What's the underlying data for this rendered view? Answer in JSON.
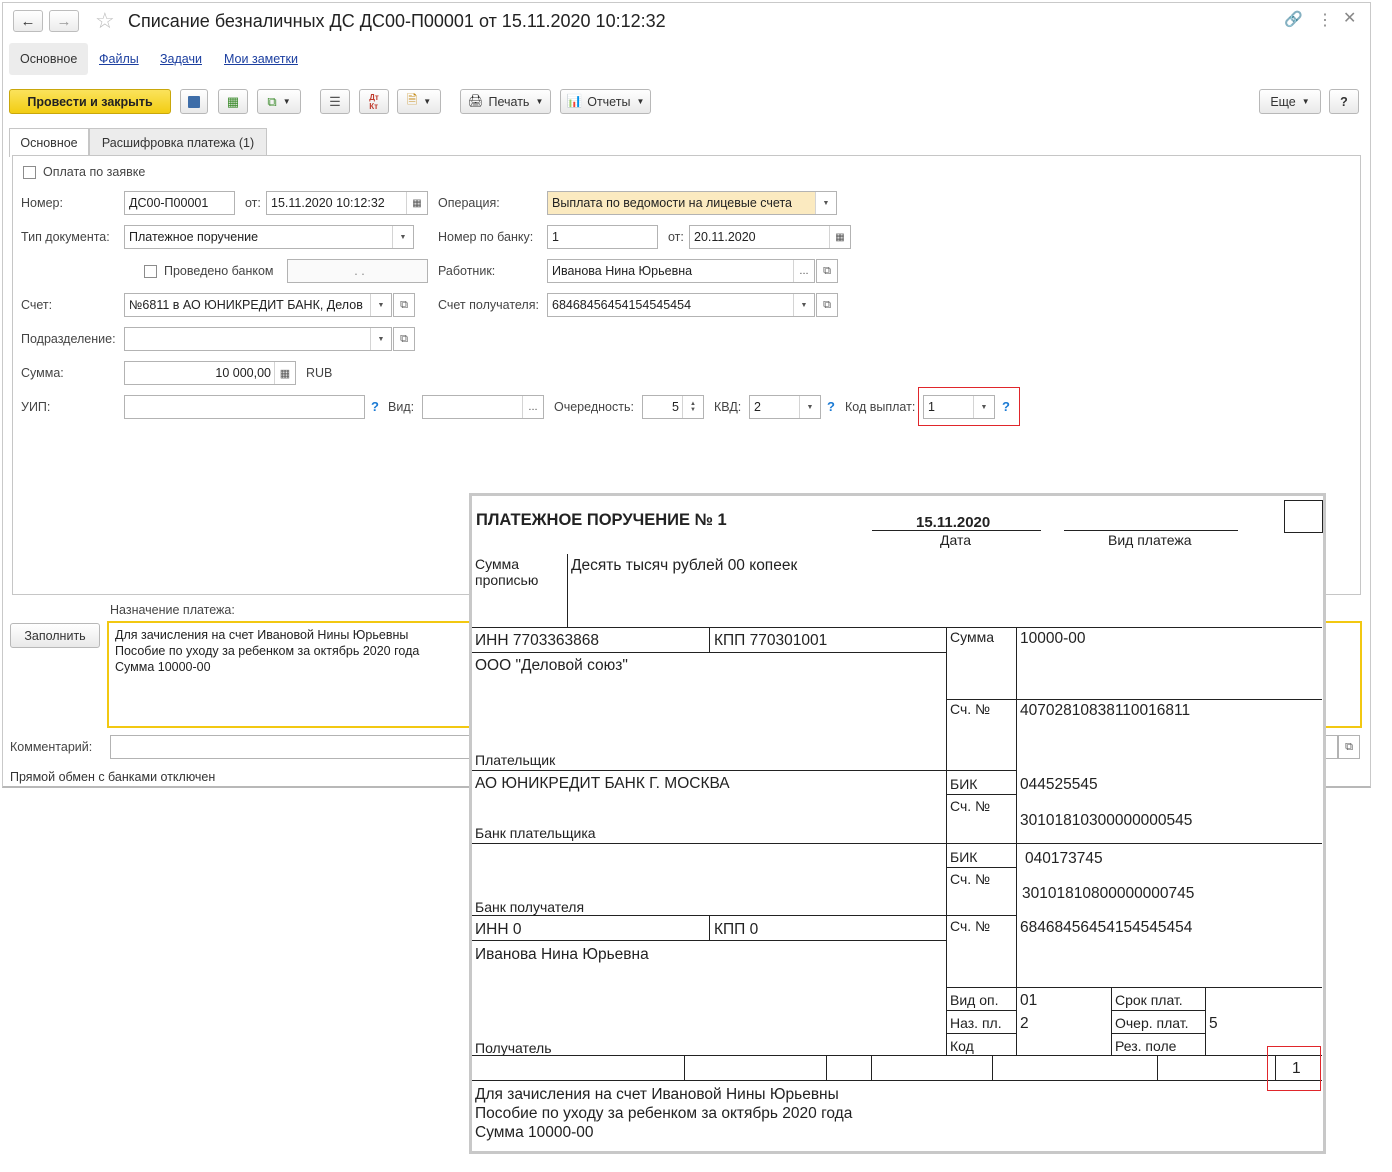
{
  "window": {
    "title": "Списание безналичных ДС ДС00-П00001 от 15.11.2020 10:12:32",
    "section_tabs": [
      "Основное",
      "Файлы",
      "Задачи",
      "Мои заметки"
    ],
    "toolbar": {
      "post_close": "Провести и закрыть",
      "print": "Печать",
      "reports": "Отчеты",
      "more": "Еще",
      "help": "?"
    },
    "tabs": [
      "Основное",
      "Расшифровка платежа (1)"
    ]
  },
  "form": {
    "request_payment_label": "Оплата по заявке",
    "number_label": "Номер:",
    "number": "ДС00-П00001",
    "from_label": "от:",
    "date": "15.11.2020 10:12:32",
    "operation_label": "Операция:",
    "operation": "Выплата по ведомости на лицевые счета",
    "doc_type_label": "Тип документа:",
    "doc_type": "Платежное поручение",
    "bank_number_label": "Номер по банку:",
    "bank_number": "1",
    "bank_from_label": "от:",
    "bank_date": "20.11.2020",
    "bank_processed_label": "Проведено банком",
    "bank_processed_date": ".  .",
    "employee_label": "Работник:",
    "employee": "Иванова Нина Юрьевна",
    "account_label": "Счет:",
    "account": "№6811 в АО ЮНИКРЕДИТ БАНК, Делов",
    "recipient_account_label": "Счет получателя:",
    "recipient_account": "68468456454154545454",
    "division_label": "Подразделение:",
    "division": "",
    "amount_label": "Сумма:",
    "amount": "10 000,00",
    "currency": "RUB",
    "uip_label": "УИП:",
    "uip": "",
    "kind_label": "Вид:",
    "kind": "",
    "priority_label": "Очередность:",
    "priority": "5",
    "kvd_label": "КВД:",
    "kvd": "2",
    "payout_code_label": "Код выплат:",
    "payout_code": "1",
    "purpose_label": "Назначение платежа:",
    "fill_button": "Заполнить",
    "purpose_lines": [
      "Для зачисления на счет Ивановой Нины Юрьевны",
      "Пособие по уходу за ребенком за октябрь 2020 года",
      "Сумма 10000-00"
    ],
    "comment_label": "Комментарий:",
    "comment": "",
    "status": "Прямой обмен с банками отключен"
  },
  "payment_order": {
    "title": "ПЛАТЕЖНОЕ ПОРУЧЕНИЕ № 1",
    "date": "15.11.2020",
    "date_caption": "Дата",
    "payment_type_caption": "Вид платежа",
    "amount_words_label": "Сумма прописью",
    "amount_words": "Десять тысяч рублей 00 копеек",
    "payer_inn": "ИНН 7703363868",
    "payer_kpp": "КПП 770301001",
    "payer_name": "ООО \"Деловой союз\"",
    "payer_caption": "Плательщик",
    "sum_label": "Сумма",
    "sum": "10000-00",
    "acc_label": "Сч. №",
    "payer_account": "40702810838110016811",
    "payer_bank": "АО ЮНИКРЕДИТ БАНК Г. МОСКВА",
    "payer_bank_caption": "Банк плательщика",
    "bik_label": "БИК",
    "payer_bik": "044525545",
    "payer_corr_account": "30101810300000000545",
    "recipient_bank_caption": "Банк получателя",
    "recipient_bik": "040173745",
    "recipient_corr_account": "30101810800000000745",
    "recipient_inn": "ИНН 0",
    "recipient_kpp": "КПП 0",
    "recipient_account": "68468456454154545454",
    "recipient_name": "Иванова Нина Юрьевна",
    "recipient_caption": "Получатель",
    "op_type_label": "Вид оп.",
    "op_type": "01",
    "purpose_code_label": "Наз. пл.",
    "purpose_code": "2",
    "code_label": "Код",
    "due_label": "Срок плат.",
    "queue_label": "Очер. плат.",
    "queue": "5",
    "reserve_label": "Рез. поле",
    "payout_code_cell": "1",
    "purpose_lines": [
      "Для зачисления на счет Ивановой Нины Юрьевны",
      "Пособие по уходу за ребенком за октябрь 2020 года",
      "Сумма 10000-00"
    ]
  },
  "colors": {
    "primary_button": "#f2cd13",
    "highlight_red": "#e0262b",
    "link": "#1c3fa0",
    "help_icon": "#1c7bd4",
    "operation_bg": "#fbeac0",
    "purpose_border": "#f2c811"
  }
}
